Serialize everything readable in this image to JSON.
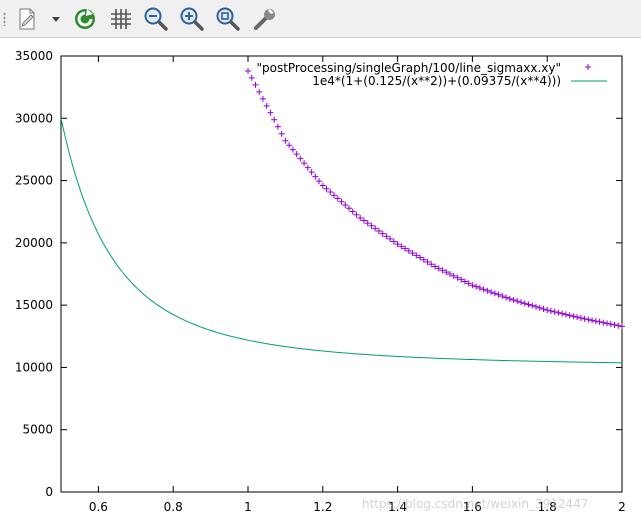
{
  "toolbar": {
    "items": [
      {
        "name": "export-icon"
      },
      {
        "name": "dropdown-arrow-icon"
      },
      {
        "name": "replot-icon"
      },
      {
        "name": "grid-icon"
      },
      {
        "name": "zoom-previous-icon"
      },
      {
        "name": "zoom-next-icon"
      },
      {
        "name": "unzoom-icon"
      },
      {
        "name": "settings-wrench-icon"
      }
    ]
  },
  "watermark": "https://blog.csdn.net/weixin_3912447",
  "colors": {
    "series_points": "#9400d3",
    "series_line": "#009e73"
  },
  "chart_data": {
    "type": "line",
    "title": "",
    "xlabel": "",
    "ylabel": "",
    "xlim": [
      0.5,
      2.0
    ],
    "ylim": [
      0,
      35000
    ],
    "x_ticks": [
      "0.6",
      "0.8",
      "1",
      "1.2",
      "1.4",
      "1.6",
      "1.8",
      "2"
    ],
    "y_ticks": [
      "0",
      "5000",
      "10000",
      "15000",
      "20000",
      "25000",
      "30000",
      "35000"
    ],
    "grid": false,
    "legend_position": "top-right",
    "series": [
      {
        "name": "\"postProcessing/singleGraph/100/line_sigmaxx.xy\"",
        "style": "points-plus",
        "x_range": [
          1.0,
          2.0
        ],
        "x": [
          1.0,
          1.1,
          1.2,
          1.3,
          1.4,
          1.5,
          1.6,
          1.7,
          1.8,
          1.9,
          2.0
        ],
        "y": [
          33800,
          28200,
          24600,
          22000,
          19900,
          18100,
          16600,
          15500,
          14600,
          13900,
          13300
        ]
      },
      {
        "name": "1e4*(1+(0.125/(x**2))+(0.09375/(x**4)))",
        "style": "line",
        "x_range": [
          0.5,
          2.0
        ],
        "x": [
          0.5,
          0.6,
          0.7,
          0.8,
          0.9,
          1.0,
          1.2,
          1.4,
          1.6,
          1.8,
          2.0
        ],
        "y": [
          30000,
          20707,
          16508,
          14242,
          12972,
          12188,
          11320,
          10882,
          10631,
          10471,
          10371
        ]
      }
    ]
  }
}
